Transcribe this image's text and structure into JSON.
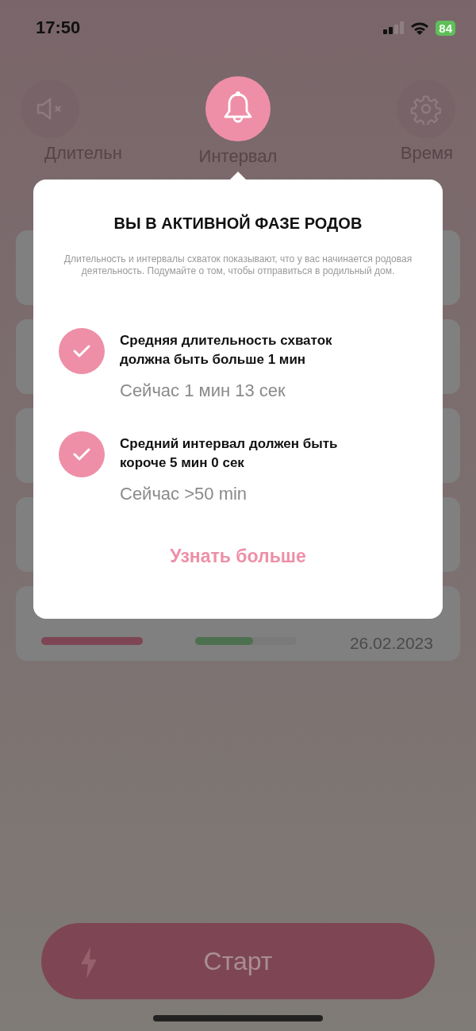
{
  "status_bar": {
    "time": "17:50",
    "battery": "84"
  },
  "toolbar": [
    {
      "kind": "sound",
      "label": "Длительн",
      "selected": false
    },
    {
      "kind": "bell",
      "label": "Интервал",
      "selected": true
    },
    {
      "kind": "settings",
      "label": "Время",
      "selected": false
    }
  ],
  "history": [
    {
      "duration": {
        "level": 1
      },
      "interval": {
        "level": 0.57
      },
      "date": "26.02.2023"
    }
  ],
  "popup": {
    "title": "ВЫ В АКТИВНОЙ ФАЗЕ РОДОВ",
    "description": "Длительность и интервалы схваток показывают, что у вас начинается родовая деятельность. Подумайте о том, чтобы отправиться в родильный дом.",
    "criteria": [
      {
        "text": "Средняя длительность схваток должна быть больше 1 мин",
        "current": "Сейчас 1 мин 13 сек",
        "checked": true
      },
      {
        "text": "Средний интервал должен быть короче 5 мин 0 сек",
        "current": "Сейчас >50 min",
        "checked": true
      }
    ],
    "link": "Узнать больше"
  },
  "start_button": {
    "label": "Старт"
  }
}
